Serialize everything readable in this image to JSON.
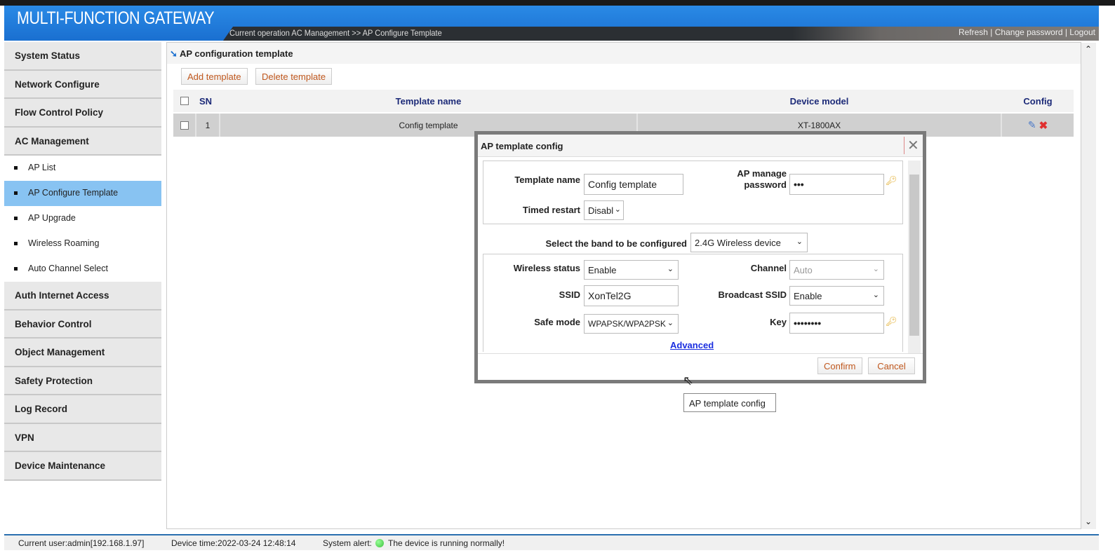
{
  "header": {
    "title": "MULTI-FUNCTION GATEWAY",
    "operation": "Current operation  AC Management >> AP Configure Template",
    "links": [
      "Refresh",
      "Change password",
      "Logout"
    ]
  },
  "sidebar": {
    "groups_top": [
      "System Status",
      "Network Configure",
      "Flow Control Policy",
      "AC Management"
    ],
    "sub_items": [
      "AP List",
      "AP Configure Template",
      "AP Upgrade",
      "Wireless Roaming",
      "Auto Channel Select"
    ],
    "active": "AP Configure Template",
    "groups_bottom": [
      "Auth Internet Access",
      "Behavior Control",
      "Object Management",
      "Safety Protection",
      "Log Record",
      "VPN",
      "Device Maintenance"
    ]
  },
  "main": {
    "title": "AP configuration template",
    "add_label": "Add template",
    "delete_label": "Delete template",
    "table": {
      "headers": {
        "sn": "SN",
        "name": "Template name",
        "model": "Device model",
        "config": "Config"
      },
      "rows": [
        {
          "sn": "1",
          "name": "Config template",
          "model": "XT-1800AX"
        }
      ]
    }
  },
  "dialog": {
    "title": "AP template config",
    "close": "✕",
    "template_name_label": "Template name",
    "template_name": "Config template",
    "ap_pw_label": "AP manage password",
    "ap_pw": "•••",
    "timed_restart_label": "Timed restart",
    "timed_restart": "Disabl",
    "band_label": "Select the band to be configured",
    "band": "2.4G Wireless device",
    "wireless_status_label": "Wireless status",
    "wireless_status": "Enable",
    "channel_label": "Channel",
    "channel": "Auto",
    "ssid_label": "SSID",
    "ssid": "XonTel2G",
    "broadcast_label": "Broadcast SSID",
    "broadcast": "Enable",
    "safe_mode_label": "Safe mode",
    "safe_mode": "WPAPSK/WPA2PSK",
    "key_label": "Key",
    "key": "••••••••",
    "advanced": "Advanced",
    "confirm": "Confirm",
    "cancel": "Cancel"
  },
  "tooltip": "AP template config",
  "status": {
    "user": "Current user:admin[192.168.1.97]",
    "time": "Device time:2022-03-24 12:48:14",
    "alert_label": "System alert:",
    "alert_text": "The device is running normally!",
    "alert_color": "#3cc13c"
  }
}
